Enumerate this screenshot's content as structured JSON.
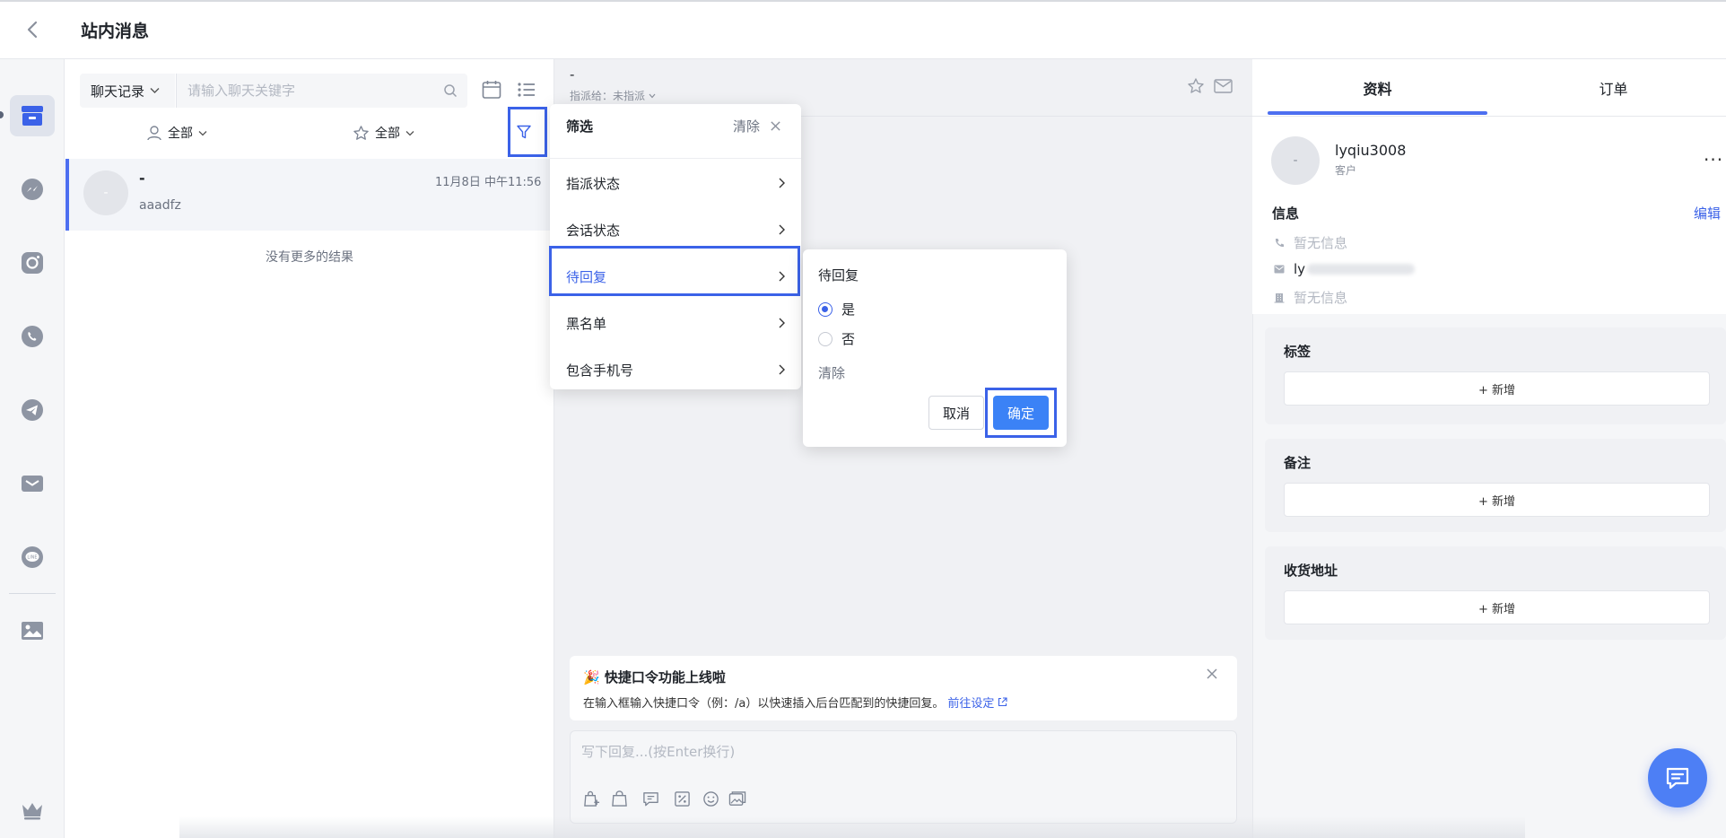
{
  "header": {
    "title": "站内消息"
  },
  "list": {
    "search_select_label": "聊天记录",
    "search_placeholder": "请输入聊天关键字",
    "filter_assignee_label": "全部",
    "filter_star_label": "全部",
    "conversation": {
      "name": "-",
      "avatar_text": "-",
      "time": "11月8日 中午11:56",
      "preview": "aaadfz"
    },
    "no_more_text": "没有更多的结果"
  },
  "chat": {
    "title": "-",
    "assign_label": "指派给：未指派",
    "notice": {
      "title": "🎉 快捷口令功能上线啦",
      "body": "在输入框输入快捷口令（例：/a）以快速插入后台匹配到的快捷回复。",
      "link": "前往设定"
    },
    "reply_placeholder": "写下回复...(按Enter换行)"
  },
  "filter_menu": {
    "title": "筛选",
    "clear": "清除",
    "items": [
      {
        "label": "指派状态"
      },
      {
        "label": "会话状态"
      },
      {
        "label": "待回复"
      },
      {
        "label": "黑名单"
      },
      {
        "label": "包含手机号"
      }
    ],
    "active_index": 2
  },
  "sub_filter": {
    "title": "待回复",
    "options": [
      {
        "label": "是",
        "checked": true
      },
      {
        "label": "否",
        "checked": false
      }
    ],
    "clear": "清除",
    "cancel": "取消",
    "confirm": "确定"
  },
  "customer": {
    "tabs": [
      "资料",
      "订单"
    ],
    "active_tab": 0,
    "avatar_text": "-",
    "name": "lyqiu3008",
    "role": "客户",
    "info_title": "信息",
    "edit_label": "编辑",
    "phone": "暂无信息",
    "email": "ly",
    "address": "暂无信息",
    "sections": [
      {
        "title": "标签",
        "add_label": "+ 新增"
      },
      {
        "title": "备注",
        "add_label": "+ 新增"
      },
      {
        "title": "收货地址",
        "add_label": "+ 新增"
      }
    ]
  },
  "colors": {
    "accent": "#3b62e8",
    "primary_button": "#3b82f6",
    "highlight_box": "#3b62e8"
  }
}
